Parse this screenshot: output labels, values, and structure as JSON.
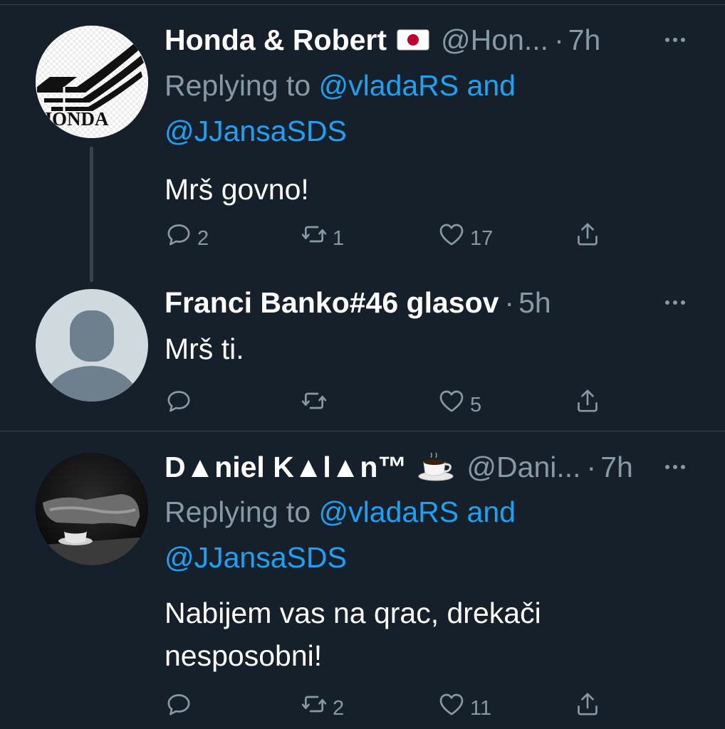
{
  "colors": {
    "background": "#15202b",
    "secondary_text": "#8899a6",
    "link": "#1da1f2",
    "divider": "#38444d"
  },
  "tweets": [
    {
      "name": "Honda & Robert",
      "flag_icon": "japan-flag-emoji",
      "handle": "@Hon...",
      "dot": "·",
      "time": "7h",
      "replying_prefix": "Replying to",
      "replying_first": "@vladaRS",
      "replying_and": "and",
      "replying_second": "@JJansaSDS",
      "text": "Mrš govno!",
      "reply_count": "2",
      "retweet_count": "1",
      "like_count": "17",
      "avatar_text": "HONDA"
    },
    {
      "name": "Franci Banko#46 glasov",
      "dot": "·",
      "time": "5h",
      "text": "Mrš ti.",
      "reply_count": "",
      "retweet_count": "",
      "like_count": "5"
    },
    {
      "name": "D▲niel K▲l▲n™",
      "coffee_icon": "coffee-cup-emoji",
      "handle": "@Dani...",
      "dot": "·",
      "time": "7h",
      "replying_prefix": "Replying to",
      "replying_first": "@vladaRS",
      "replying_and": "and",
      "replying_second": "@JJansaSDS",
      "text_line1": "Nabijem vas na qrac, drekači",
      "text_line2": "nesposobni!",
      "reply_count": "",
      "retweet_count": "2",
      "like_count": "11"
    }
  ]
}
